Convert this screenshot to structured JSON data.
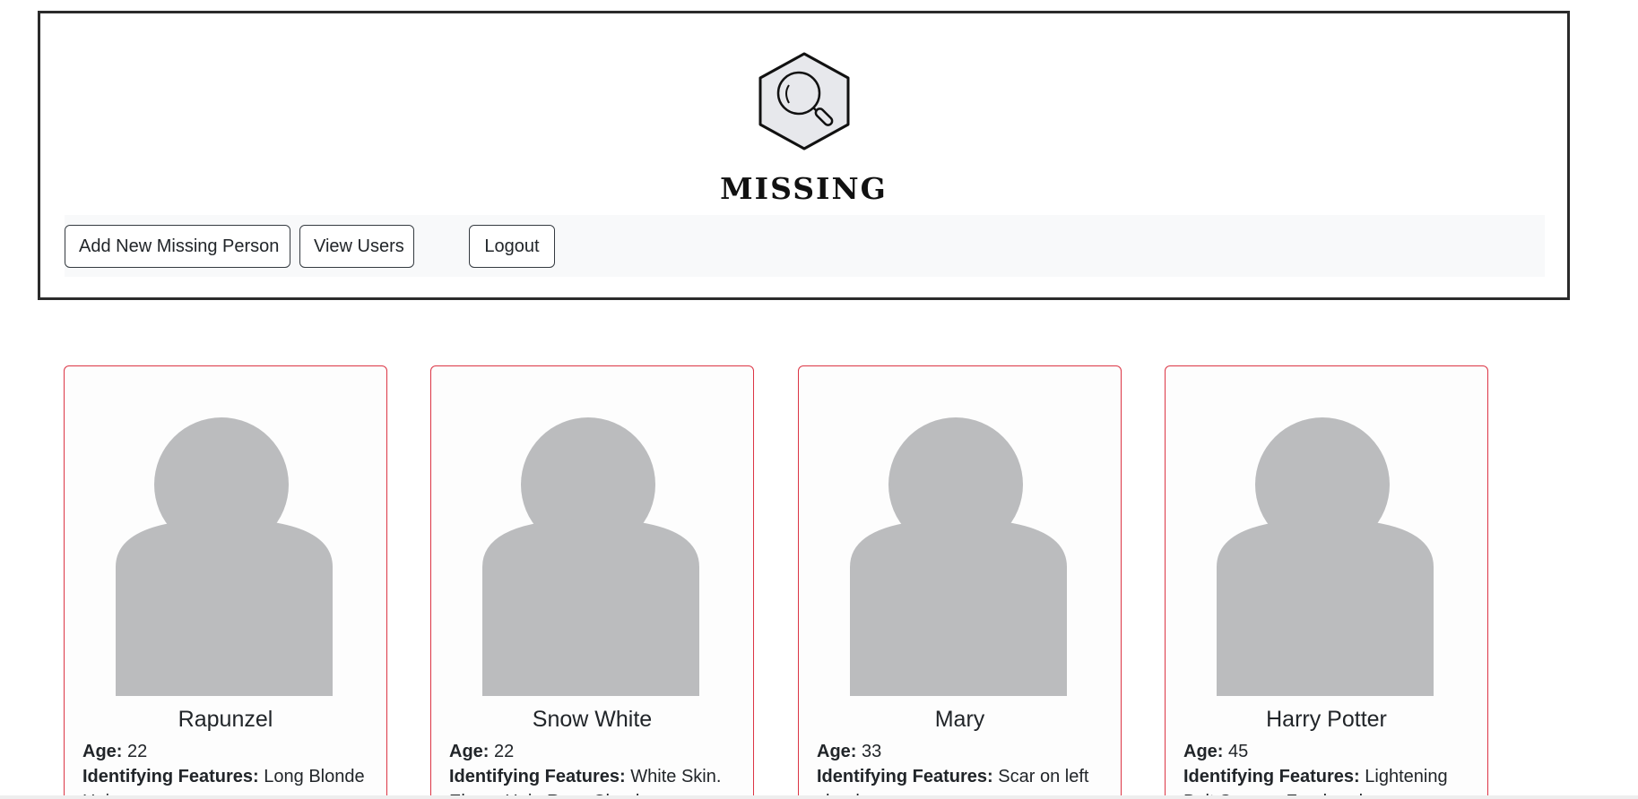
{
  "brand": {
    "title": "MISSING",
    "logo_icon": "magnifier-hexagon-icon"
  },
  "nav": {
    "add_label": "Add New Missing Person",
    "users_label": "View Users",
    "logout_label": "Logout"
  },
  "labels": {
    "age": "Age:",
    "features": "Identifying Features:"
  },
  "colors": {
    "card_border": "#dc3545",
    "avatar": "#bbbcbe",
    "nav_bg": "#f8f9fa"
  },
  "cards": [
    {
      "name": "Rapunzel",
      "age": "22",
      "features": "Long Blonde Hair"
    },
    {
      "name": "Snow White",
      "age": "22",
      "features": "White Skin. Ebony Hair. Rosy Cheeks"
    },
    {
      "name": "Mary",
      "age": "33",
      "features": "Scar on left cheek"
    },
    {
      "name": "Harry Potter",
      "age": "45",
      "features": "Lightening Bolt Scar on Forehead"
    }
  ]
}
